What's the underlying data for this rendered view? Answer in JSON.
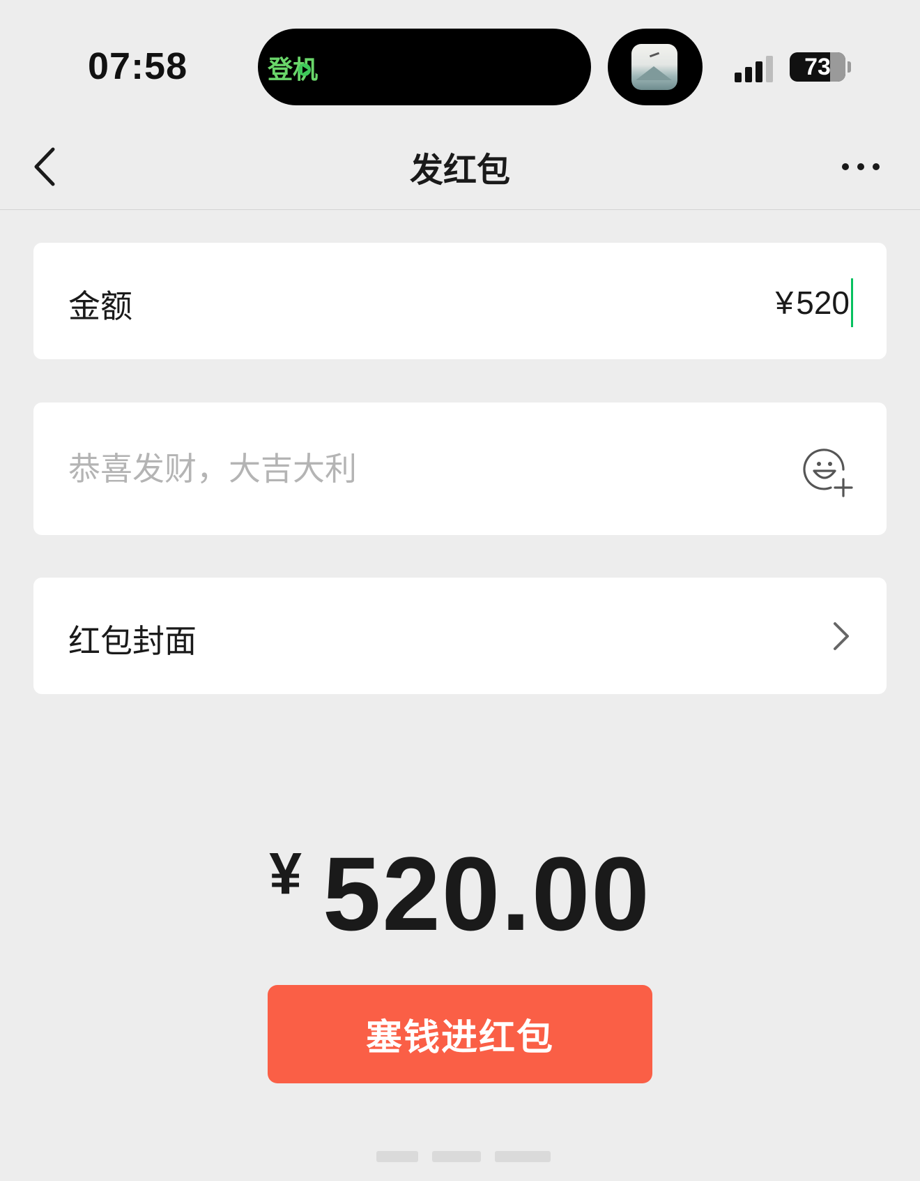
{
  "status_bar": {
    "time": "07:58",
    "live_activity_label": "登机",
    "battery_level": "73",
    "battery_fraction": 0.73
  },
  "nav": {
    "title": "发红包",
    "back_icon": "chevron-left-icon",
    "more_icon": "more-horizontal-icon"
  },
  "form": {
    "amount": {
      "label": "金额",
      "currency": "¥",
      "value": "520"
    },
    "message": {
      "placeholder": "恭喜发财，大吉大利",
      "value": "",
      "emoji_icon": "emoji-add-icon"
    },
    "cover": {
      "label": "红包封面",
      "chevron_icon": "chevron-right-icon"
    }
  },
  "total": {
    "currency": "¥",
    "value": "520.00"
  },
  "submit": {
    "label": "塞钱进红包"
  },
  "colors": {
    "background": "#ededed",
    "card": "#ffffff",
    "primary_button": "#fa5f46",
    "caret": "#07c160",
    "placeholder": "#b4b4b4",
    "text": "#1a1a1a",
    "live_activity_text": "#6ad66a"
  }
}
